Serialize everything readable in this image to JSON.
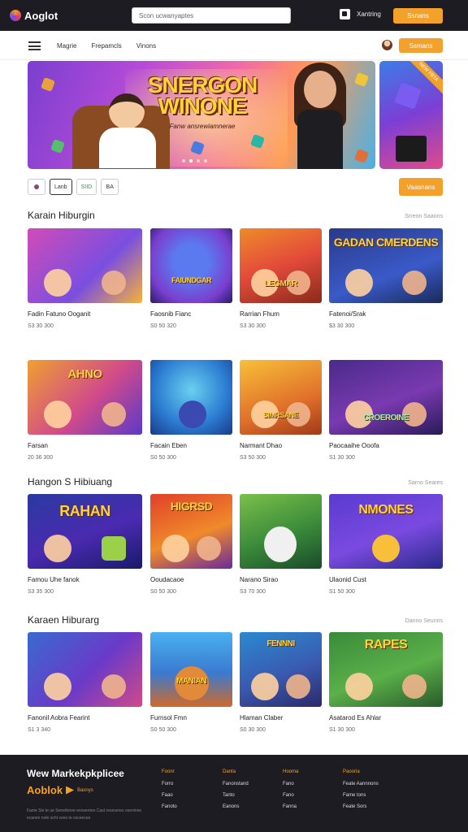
{
  "header": {
    "logo_text": "Aoglot",
    "search_placeholder": "Scon ucwanyaptes",
    "cart_label": "Xantring",
    "cta_label": "Ssnans"
  },
  "nav": {
    "links": [
      "Magrie",
      "Frepamcls",
      "Vinons"
    ],
    "cta_label": "Ssmans"
  },
  "hero": {
    "title": "SNERGON WINONE",
    "subtitle": "Fanw ansrewiamnerae",
    "side_ribbon": "NEW FBTA"
  },
  "filters": {
    "chips": [
      "",
      "Lanb",
      "SIID",
      "BA"
    ],
    "cta_label": "Vaasnans"
  },
  "sections": [
    {
      "title": "Karain Hiburgin",
      "link": "Srreon Saaons",
      "cards": [
        {
          "thumb_title": "",
          "name": "Fadin Fatuno Ooganit",
          "meta": "S3  30 300"
        },
        {
          "thumb_title": "FAIUNDGAR",
          "name": "Faosnib Fianc",
          "meta": "S0  50 320"
        },
        {
          "thumb_title": "LEGMAR",
          "name": "Rarrian Fhum",
          "meta": "S3  30 300"
        },
        {
          "thumb_title": "GADAN CMERDENS",
          "name": "Fatenoi/Srak",
          "meta": "$3  30 300"
        }
      ]
    },
    {
      "title": "",
      "link": "",
      "cards": [
        {
          "thumb_title": "AHNO",
          "name": "Farsan",
          "meta": "20  36 300"
        },
        {
          "thumb_title": "",
          "name": "Facain Eben",
          "meta": "S0  50 300"
        },
        {
          "thumb_title": "SIMRSANE",
          "name": "Narmant Dhao",
          "meta": "S3  50 300"
        },
        {
          "thumb_title": "CROEROINE",
          "name": "Paocaaihe Ooofa",
          "meta": "S1  30 300"
        }
      ]
    },
    {
      "title": "Hangon S Hibiuang",
      "link": "Sarno Seares",
      "cards": [
        {
          "thumb_title": "RAHAN",
          "name": "Famou Uhe fanok",
          "meta": "S3  35 300"
        },
        {
          "thumb_title": "HIGRSD",
          "name": "Ooudacaoe",
          "meta": "S0  50 300"
        },
        {
          "thumb_title": "",
          "name": "Narano Sirao",
          "meta": "S3  70 300"
        },
        {
          "thumb_title": "NMONES",
          "name": "Ulaonid Cust",
          "meta": "S1  50 300"
        }
      ]
    },
    {
      "title": "Karaen Hiburarg",
      "link": "Danno Seunns",
      "cards": [
        {
          "thumb_title": "",
          "name": "Fanonil Aobra Fearint",
          "meta": "S1  3 340"
        },
        {
          "thumb_title": "MANIAN",
          "name": "Furnsol Fmn",
          "meta": "S0  50 300"
        },
        {
          "thumb_title": "FENNNI",
          "name": "Hlaman Claber",
          "meta": "S0  30 300"
        },
        {
          "thumb_title": "RAPES",
          "name": "Asatarod Es Ahlar",
          "meta": "S1  30 300"
        }
      ]
    }
  ],
  "footer": {
    "brand_line": "Wew Markekpkplicee",
    "logo_text": "Aoblok",
    "logo_small": "Basnys",
    "legal": "Fame Sie te ue Senettoree eonsenten Cast reseseres oseninne ecanen nole ocht cees te ceceecee",
    "columns": [
      {
        "heading": "Foonr",
        "links": [
          "Forro",
          "Faao",
          "Fanoto"
        ]
      },
      {
        "heading": "Danta",
        "links": [
          "Fanonstand",
          "Tanto",
          "Eanons"
        ]
      },
      {
        "heading": "Hooma",
        "links": [
          "Fano",
          "Fano",
          "Fanna"
        ]
      },
      {
        "heading": "Paooria",
        "links": [
          "Feate Aannnons",
          "Fame tons",
          "Feate Sors"
        ]
      }
    ]
  }
}
